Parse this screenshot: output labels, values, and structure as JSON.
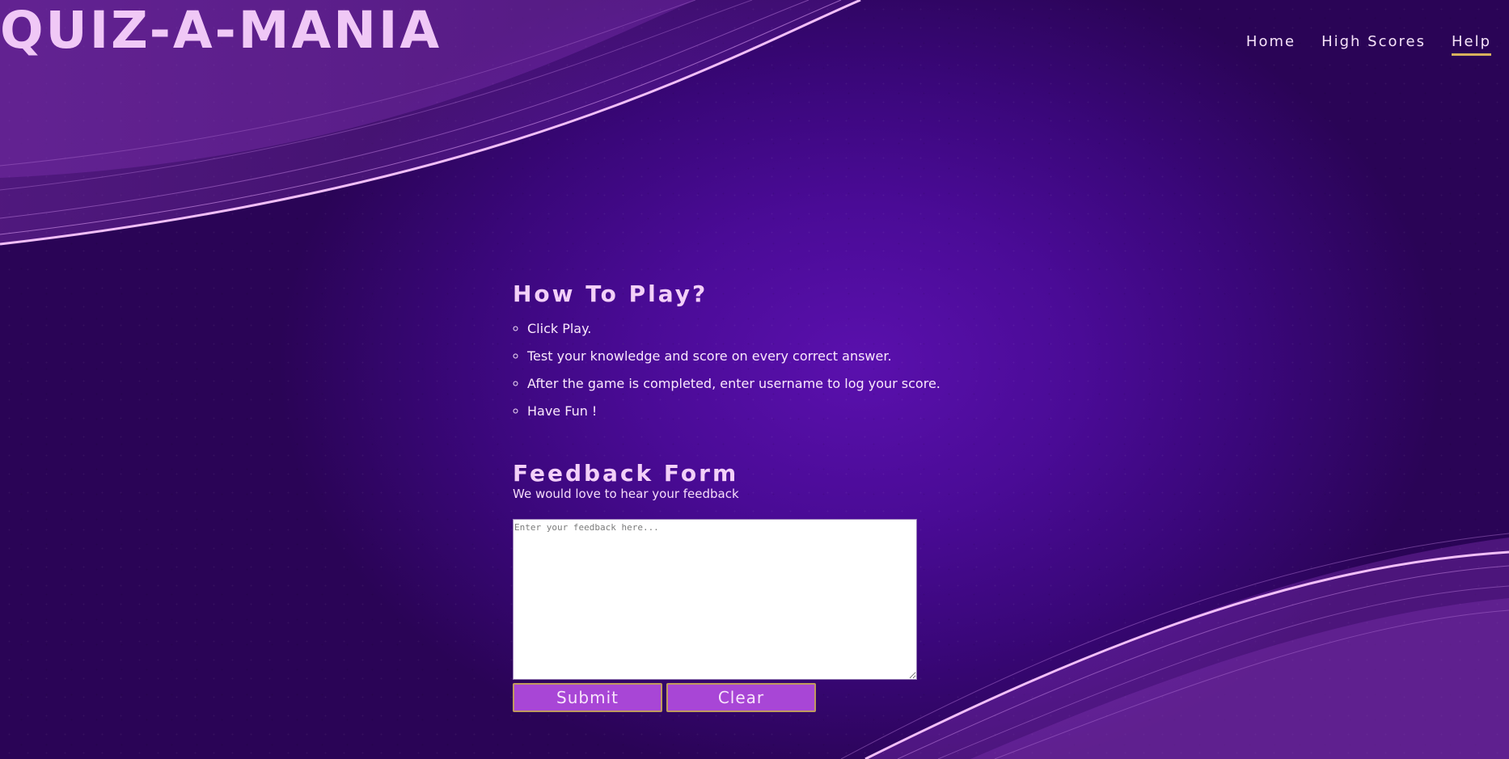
{
  "app": {
    "logo": "QUIZ-A-MANIA"
  },
  "nav": {
    "items": [
      {
        "label": "Home",
        "active": false
      },
      {
        "label": "High Scores",
        "active": false
      },
      {
        "label": "Help",
        "active": true
      }
    ]
  },
  "help": {
    "title": "How To Play?",
    "steps": [
      "Click Play.",
      "Test your knowledge and score on every correct answer.",
      "After the game is completed, enter username to log your score.",
      "Have Fun !"
    ]
  },
  "feedback": {
    "title": "Feedback Form",
    "subtitle": "We would love to hear your feedback",
    "placeholder": "Enter your feedback here...",
    "value": "",
    "submit_label": "Submit",
    "clear_label": "Clear"
  },
  "colors": {
    "background": "#4a0b96",
    "accent_pink": "#f0c8f6",
    "button": "#a846d6",
    "nav_underline": "#d9b25c"
  }
}
